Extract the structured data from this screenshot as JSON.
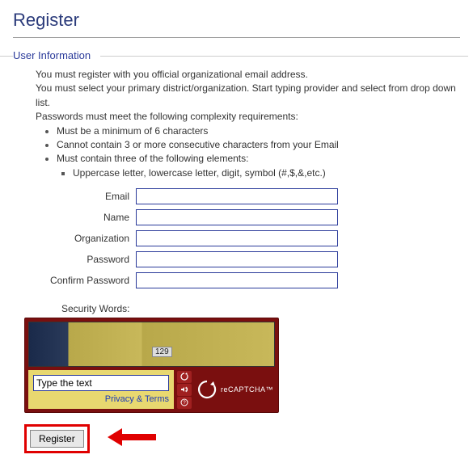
{
  "page": {
    "title": "Register"
  },
  "section": {
    "label": "User Information"
  },
  "instructions": {
    "line1": "You must register with you official organizational email address.",
    "line2": "You must select your primary district/organization. Start typing provider and select from drop down list.",
    "line3": "Passwords must meet the following complexity requirements:",
    "req1": "Must be a minimum of 6 characters",
    "req2": "Cannot contain 3 or more consecutive characters from your Email",
    "req3": "Must contain three of the following elements:",
    "req3a": "Uppercase letter, lowercase letter, digit, symbol (#,$,&,etc.)"
  },
  "fields": {
    "email": {
      "label": "Email",
      "value": ""
    },
    "name": {
      "label": "Name",
      "value": ""
    },
    "organization": {
      "label": "Organization",
      "value": ""
    },
    "password": {
      "label": "Password",
      "value": ""
    },
    "confirm_password": {
      "label": "Confirm Password",
      "value": ""
    }
  },
  "captcha": {
    "label": "Security Words:",
    "image_text": "129",
    "input_placeholder": "Type the text",
    "privacy": "Privacy & Terms",
    "logo": "reCAPTCHA™"
  },
  "buttons": {
    "register": "Register"
  }
}
